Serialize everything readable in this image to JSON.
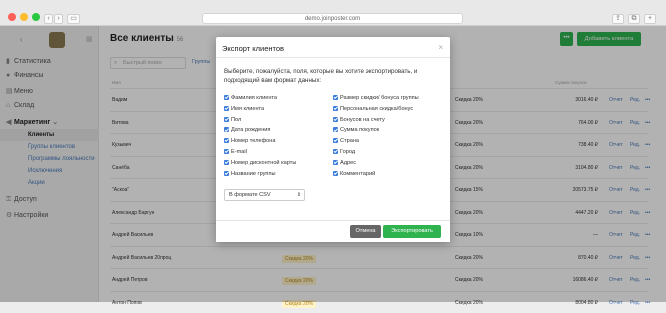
{
  "browser": {
    "url": "demo.joinposter.com"
  },
  "sidebar": {
    "items": [
      {
        "label": "Статистика",
        "icon": "chart-icon"
      },
      {
        "label": "Финансы",
        "icon": "coin-icon"
      },
      {
        "label": "Меню",
        "icon": "menu-icon"
      },
      {
        "label": "Склад",
        "icon": "warehouse-icon"
      },
      {
        "label": "Маркетинг",
        "icon": "megaphone-icon"
      },
      {
        "label": "Доступ",
        "icon": "key-icon"
      },
      {
        "label": "Настройки",
        "icon": "gear-icon"
      }
    ],
    "sub_items": [
      "Клиенты",
      "Группы клиентов",
      "Программы лояльности",
      "Исключения",
      "Акции"
    ]
  },
  "main": {
    "title": "Все клиенты",
    "count": "56",
    "search_placeholder": "Быстрый поиск",
    "filter_label": "Группы",
    "add_button": "Добавить клиента",
    "dots_label": "•••",
    "col_name": "Имя",
    "col_purchases": "Сумма покупок",
    "rows": [
      {
        "name": "Вадим",
        "group": "",
        "discount": "Скидка 20%",
        "sum": "3016.40 ₽"
      },
      {
        "name": "Витова",
        "group": "",
        "discount": "Скидка 20%",
        "sum": "764.00 ₽"
      },
      {
        "name": "Кузьмич",
        "group": "",
        "discount": "Скидка 20%",
        "sum": "738.40 ₽"
      },
      {
        "name": "Санёба",
        "group": "",
        "discount": "Скидка 20%",
        "sum": "3104.80 ₽"
      },
      {
        "name": "\"Аскоа\"",
        "group": "",
        "discount": "Скидка 15%",
        "sum": "20573.75 ₽"
      },
      {
        "name": "Александр Баргун",
        "group": "",
        "discount": "Скидка 20%",
        "sum": "4447.20 ₽"
      },
      {
        "name": "Андрей Васильев",
        "group": "",
        "discount": "Скидка 10%",
        "sum": "—"
      },
      {
        "name": "Андрей Васильев 20проц",
        "group": "Скидка 20%",
        "discount": "Скидка 20%",
        "sum": "870.40 ₽"
      },
      {
        "name": "Андрей Петров",
        "group": "Скидка 20%",
        "discount": "Скидка 20%",
        "sum": "16086.40 ₽"
      },
      {
        "name": "Антон Попов",
        "group": "Скидка 20%",
        "discount": "Скидка 20%",
        "sum": "8004.80 ₽"
      }
    ],
    "report_link": "Отчет",
    "edit_link": "Ред.",
    "row_more": "•••"
  },
  "modal": {
    "title": "Экспорт клиентов",
    "close": "×",
    "intro": "Выберите, пожалуйста, поля, которые вы хотите экспортировать, и подходящий вам формат данных:",
    "left_fields": [
      "Фамилия клиента",
      "Имя клиента",
      "Пол",
      "Дата рождения",
      "Номер телефона",
      "E-mail",
      "Номер дисконтной карты",
      "Название группы"
    ],
    "right_fields": [
      "Размер скидки/ бонуса группы",
      "Персональная скидка/бонус",
      "Бонусов на счету",
      "Сумма покупок",
      "Страна",
      "Город",
      "Адрес",
      "Комментарий"
    ],
    "format_value": "В формате CSV",
    "cancel_label": "Отмена",
    "export_label": "Экспортировать"
  }
}
